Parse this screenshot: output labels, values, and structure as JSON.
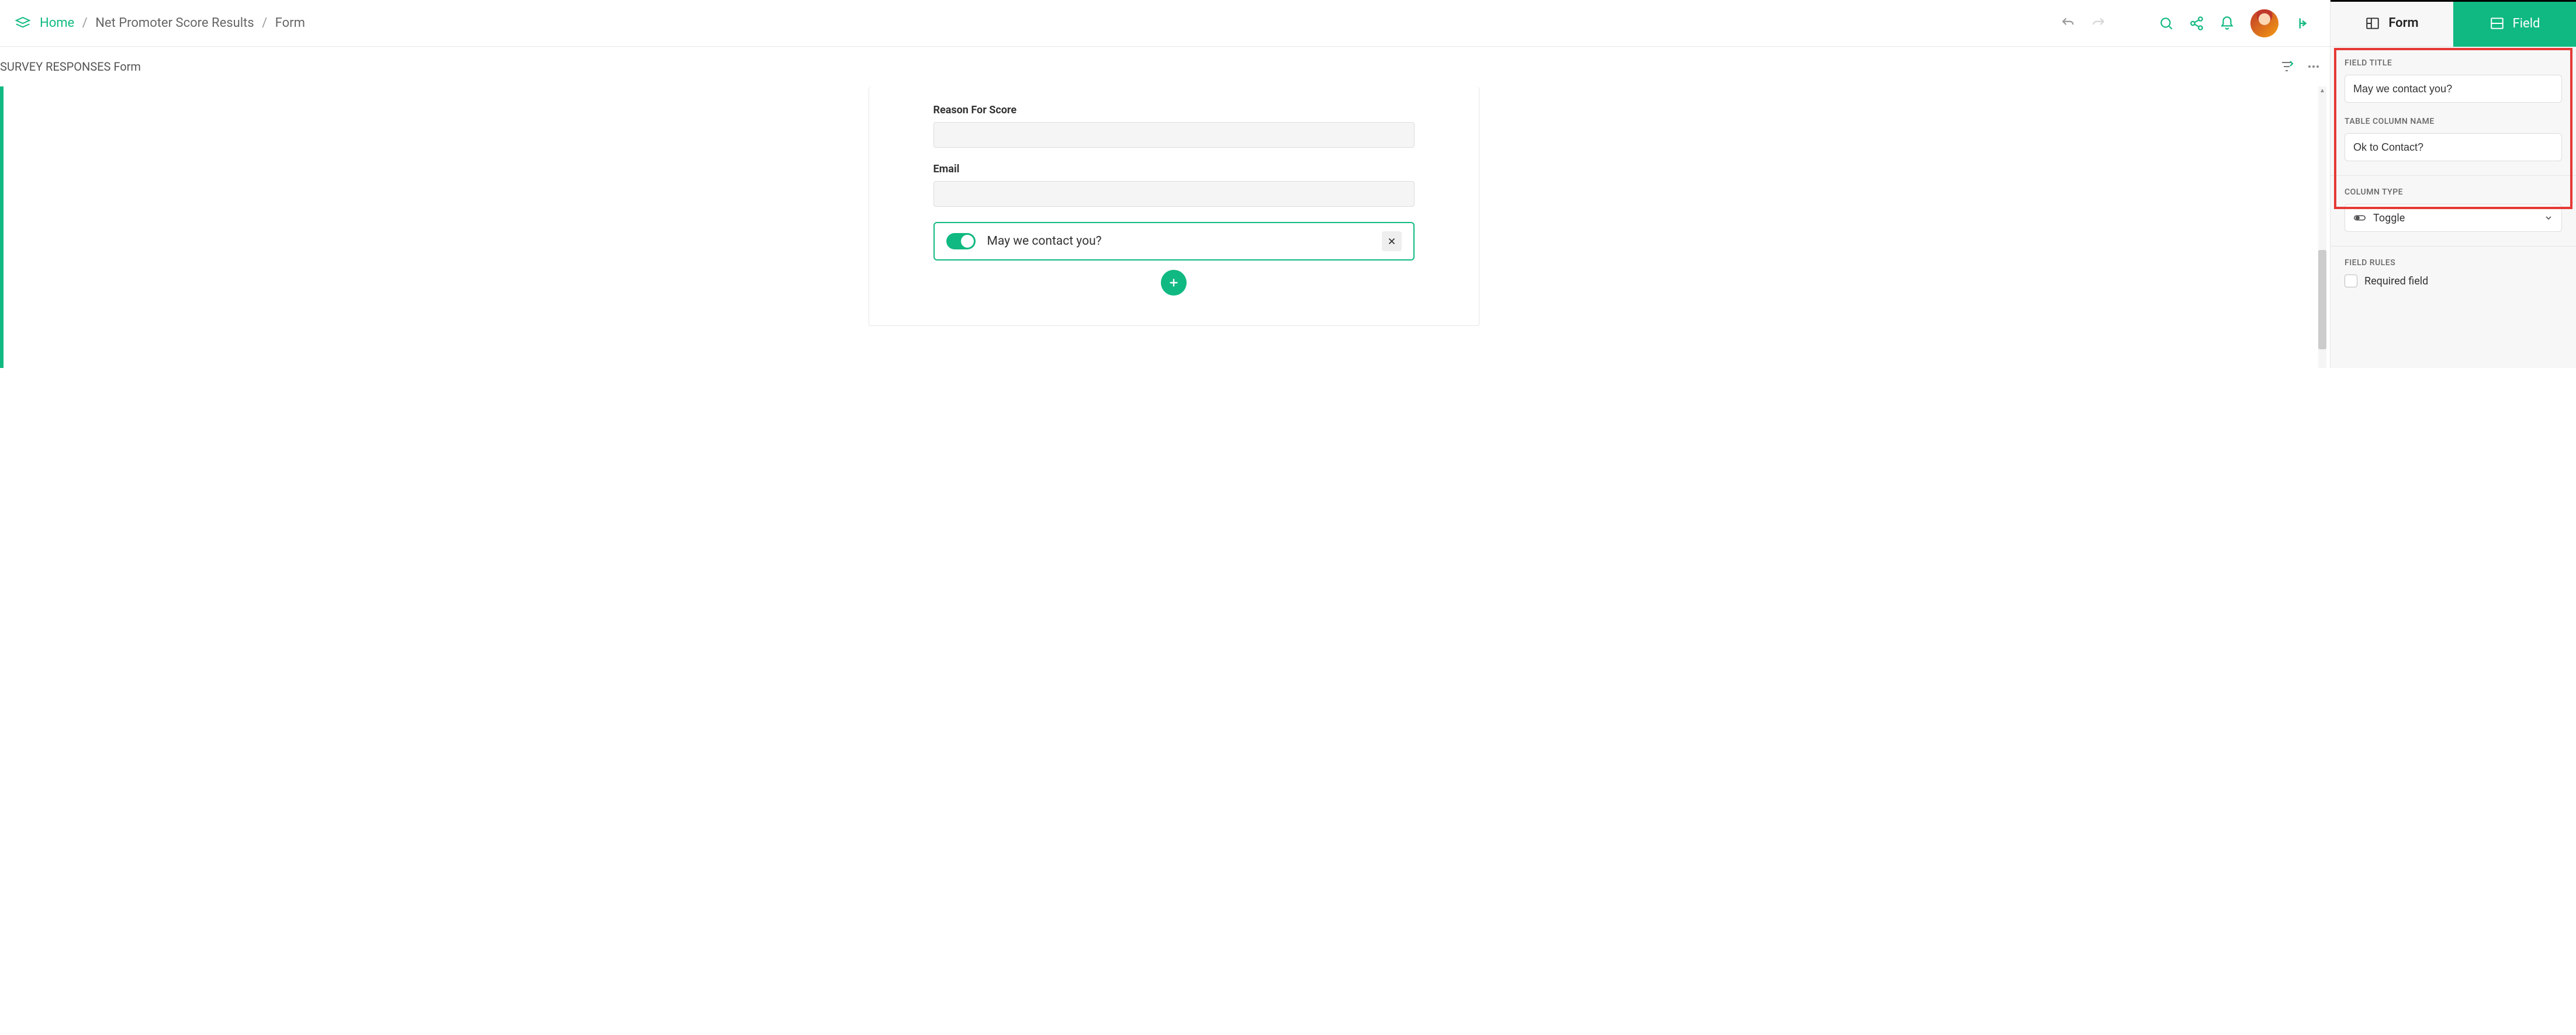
{
  "breadcrumb": {
    "home": "Home",
    "mid": "Net Promoter Score Results",
    "leaf": "Form"
  },
  "subheader": {
    "title": "SURVEY RESPONSES Form"
  },
  "form": {
    "fields": [
      {
        "label": "Reason For Score"
      },
      {
        "label": "Email"
      }
    ],
    "selected_field": {
      "label": "May we contact you?"
    }
  },
  "side": {
    "tabs": {
      "form": "Form",
      "field": "Field"
    },
    "field_title_label": "FIELD TITLE",
    "field_title_value": "May we contact you?",
    "column_name_label": "TABLE COLUMN NAME",
    "column_name_value": "Ok to Contact?",
    "column_type_label": "COLUMN TYPE",
    "column_type_value": "Toggle",
    "field_rules_label": "FIELD RULES",
    "required_label": "Required field"
  }
}
